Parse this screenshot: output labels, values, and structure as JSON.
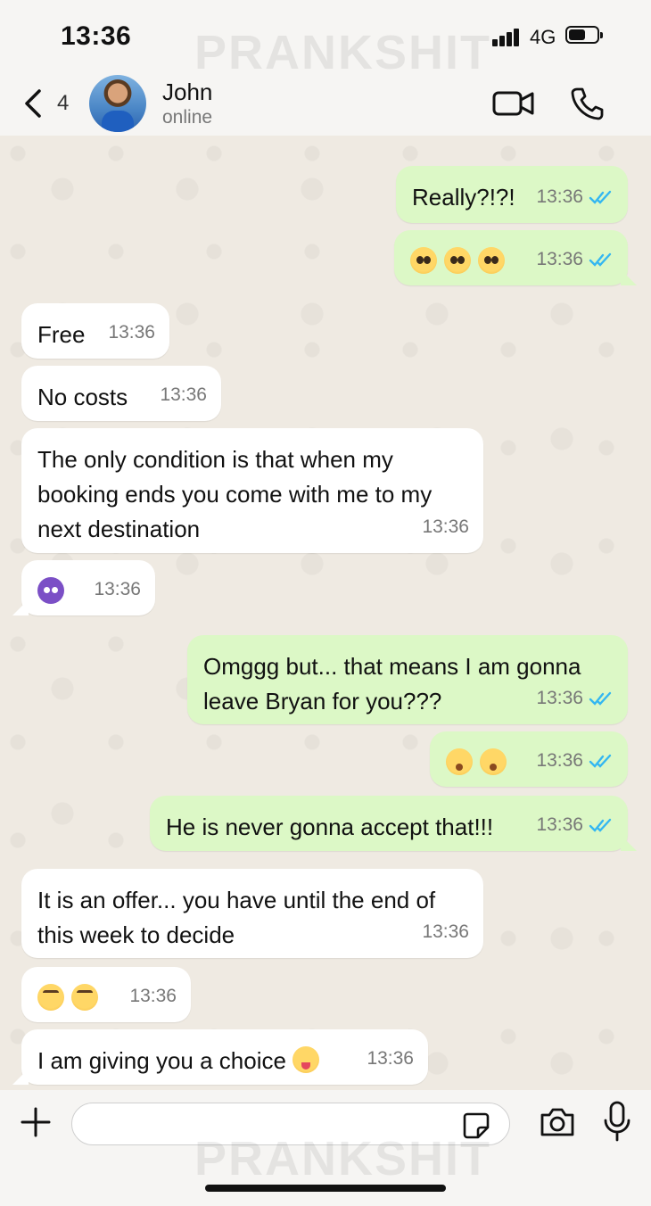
{
  "status": {
    "time": "13:36",
    "network": "4G",
    "watermark": "PRANKSHIT"
  },
  "header": {
    "back_count": "4",
    "contact_name": "John",
    "presence": "online"
  },
  "messages": [
    {
      "side": "out",
      "text": "Really?!?!",
      "time": "13:36",
      "read": true
    },
    {
      "side": "out",
      "emojis": [
        "pleading-face",
        "pleading-face",
        "pleading-face"
      ],
      "time": "13:36",
      "read": true
    },
    {
      "side": "in",
      "text": "Free",
      "time": "13:36"
    },
    {
      "side": "in",
      "text": "No costs",
      "time": "13:36"
    },
    {
      "side": "in",
      "text": "The only condition is that when my booking ends you come with me to my next destination",
      "time": "13:36"
    },
    {
      "side": "in",
      "emojis": [
        "smiling-face-with-horns"
      ],
      "time": "13:36"
    },
    {
      "side": "out",
      "text": "Omggg but... that means I am gonna leave Bryan for you???",
      "time": "13:36",
      "read": true
    },
    {
      "side": "out",
      "emojis": [
        "face-with-open-eyes-and-hand-over-mouth",
        "face-with-open-eyes-and-hand-over-mouth"
      ],
      "time": "13:36",
      "read": true
    },
    {
      "side": "out",
      "text": "He is never gonna accept that!!!",
      "time": "13:36",
      "read": true
    },
    {
      "side": "in",
      "text": "It is an offer... you have until the end of this week to decide",
      "time": "13:36"
    },
    {
      "side": "in",
      "emojis": [
        "face-with-rolling-eyes",
        "face-with-rolling-eyes"
      ],
      "time": "13:36"
    },
    {
      "side": "in",
      "text": "I am giving you a choice",
      "emojis": [
        "zany-face"
      ],
      "time": "13:36"
    }
  ],
  "input": {
    "placeholder": ""
  },
  "colors": {
    "outgoing_bubble": "#dcf8c6",
    "incoming_bubble": "#ffffff",
    "read_check": "#34b7f1"
  },
  "icons": [
    "back-chevron-icon",
    "video-call-icon",
    "phone-icon",
    "plus-icon",
    "sticker-icon",
    "camera-icon",
    "mic-icon"
  ]
}
